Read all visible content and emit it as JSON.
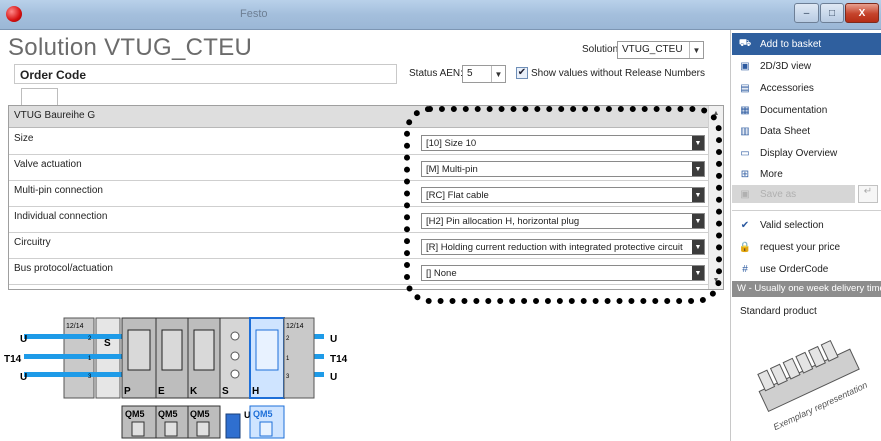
{
  "window": {
    "title": "Festo",
    "min": "–",
    "max": "□",
    "close": "X"
  },
  "header": {
    "title": "Solution VTUG_CTEU",
    "solution_label": "Solution:",
    "solution_value": "VTUG_CTEU",
    "order_code_label": "Order Code",
    "status_label": "Status AEN:",
    "status_value": "5",
    "show_values_label": "Show values without Release Numbers",
    "show_values_checked": true
  },
  "grid": {
    "header": "VTUG Baureihe G",
    "rows": [
      {
        "label": "Size",
        "value": "[10] Size 10"
      },
      {
        "label": "Valve actuation",
        "value": "[M] Multi-pin"
      },
      {
        "label": "Multi-pin connection",
        "value": "[RC] Flat cable"
      },
      {
        "label": "Individual connection",
        "value": "[H2] Pin allocation H, horizontal plug"
      },
      {
        "label": "Circuitry",
        "value": "[R] Holding current reduction with integrated protective circuit"
      },
      {
        "label": "Bus protocol/actuation",
        "value": "[] None"
      }
    ]
  },
  "diagram": {
    "port_u": "U",
    "port_t14": "T14",
    "port_1214": "12/14",
    "module_s": "S",
    "modules": [
      "P",
      "E",
      "K",
      "S",
      "H"
    ],
    "qm": [
      "QM5",
      "QM5",
      "QM5",
      "U",
      "QM5"
    ],
    "side_labels": [
      "2",
      "1",
      "3"
    ]
  },
  "sidebar": {
    "items": [
      {
        "label": "Add to basket",
        "icon": "basket-icon",
        "glyph": "⛟"
      },
      {
        "label": "2D/3D view",
        "icon": "cad-view-icon",
        "glyph": "▣"
      },
      {
        "label": "Accessories",
        "icon": "accessories-icon",
        "glyph": "▤"
      },
      {
        "label": "Documentation",
        "icon": "pdf-icon",
        "glyph": "▦"
      },
      {
        "label": "Data Sheet",
        "icon": "datasheet-icon",
        "glyph": "▥"
      },
      {
        "label": "Display Overview",
        "icon": "display-icon",
        "glyph": "▭"
      },
      {
        "label": "More",
        "icon": "plus-icon",
        "glyph": "⊞"
      },
      {
        "label": "Save as",
        "icon": "save-icon",
        "glyph": "▣"
      }
    ],
    "status_items": [
      {
        "label": "Valid selection",
        "icon": "check-icon",
        "glyph": "✔"
      },
      {
        "label": "request your price",
        "icon": "lock-icon",
        "glyph": "🔒"
      },
      {
        "label": "use OrderCode",
        "icon": "hash-icon",
        "glyph": "#"
      }
    ],
    "delivery": "W - Usually one week delivery time",
    "product_type": "Standard product",
    "image_caption": "Exemplary representation"
  },
  "colors": {
    "accent": "#2f5f9e",
    "grid_header": "#dedede",
    "pipe": "#1e9be8"
  }
}
